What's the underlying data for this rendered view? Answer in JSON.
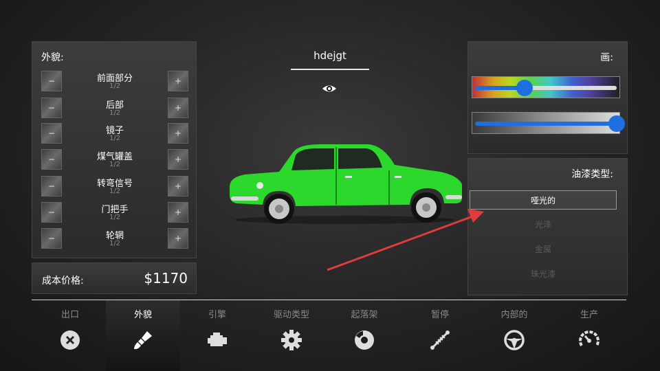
{
  "appearance": {
    "title": "外貌:",
    "minus_label": "−",
    "plus_label": "+",
    "options": [
      {
        "name": "前面部分",
        "value": "1/2"
      },
      {
        "name": "后部",
        "value": "1/2"
      },
      {
        "name": "镜子",
        "value": "1/2"
      },
      {
        "name": "煤气罐盖",
        "value": "1/2"
      },
      {
        "name": "转弯信号",
        "value": "1/2"
      },
      {
        "name": "门把手",
        "value": "1/2"
      },
      {
        "name": "轮辋",
        "value": "1/2"
      }
    ]
  },
  "cost": {
    "label": "成本价格:",
    "value": "$1170"
  },
  "car": {
    "name": "hdejgt",
    "color": "#2bd82b",
    "view_icon": "eye-icon"
  },
  "paint": {
    "title": "画:",
    "hue_level": 0.35,
    "shade_level": 1.0,
    "accent": "#1f6fe0"
  },
  "paint_type": {
    "title": "油漆类型:",
    "options": [
      "哑光的",
      "光泽",
      "金属",
      "珠光漆"
    ],
    "selected": 0
  },
  "annotation_arrow_color": "#e03c3c",
  "tabs": [
    {
      "label": "出口",
      "icon": "close-circle-icon"
    },
    {
      "label": "外貌",
      "icon": "paint-brush-icon"
    },
    {
      "label": "引擎",
      "icon": "engine-icon"
    },
    {
      "label": "驱动类型",
      "icon": "gear-icon"
    },
    {
      "label": "起落架",
      "icon": "brake-disc-icon"
    },
    {
      "label": "暂停",
      "icon": "suspension-icon"
    },
    {
      "label": "内部的",
      "icon": "steering-wheel-icon"
    },
    {
      "label": "生产",
      "icon": "speedometer-icon"
    }
  ],
  "active_tab": 1
}
